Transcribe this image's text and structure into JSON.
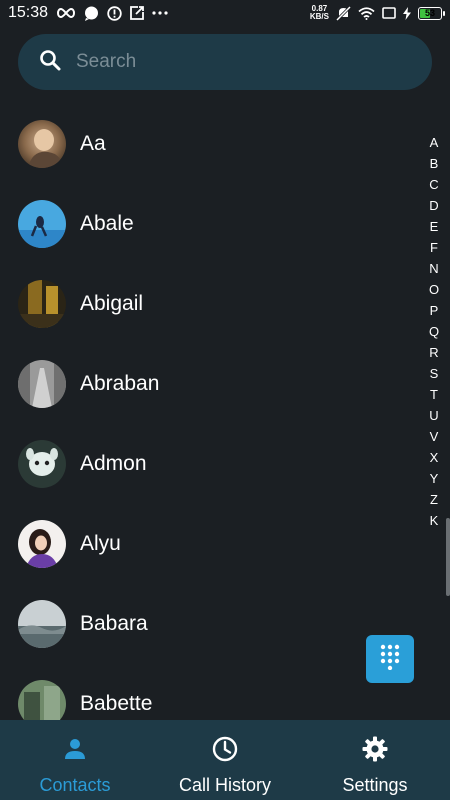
{
  "status_bar": {
    "time": "15:38",
    "speed_value": "0.87",
    "speed_unit": "KB/S",
    "battery": "53",
    "battery_level": 0.53,
    "icons": [
      "infinity-icon",
      "chat-bubble-icon",
      "alert-icon",
      "upload-icon",
      "more-dots-icon",
      "mute-icon",
      "wifi-icon",
      "screen-icon",
      "charging-icon"
    ]
  },
  "search": {
    "placeholder": "Search",
    "value": ""
  },
  "contacts": [
    {
      "name": "Aa"
    },
    {
      "name": "Abale"
    },
    {
      "name": "Abigail"
    },
    {
      "name": "Abraban"
    },
    {
      "name": "Admon"
    },
    {
      "name": "Alyu"
    },
    {
      "name": "Babara"
    },
    {
      "name": "Babette"
    }
  ],
  "alphabet_index": [
    "A",
    "B",
    "C",
    "D",
    "E",
    "F",
    "N",
    "O",
    "P",
    "Q",
    "R",
    "S",
    "T",
    "U",
    "V",
    "X",
    "Y",
    "Z",
    "K"
  ],
  "bottom_nav": [
    {
      "label": "Contacts",
      "icon": "person-icon",
      "active": true
    },
    {
      "label": "Call History",
      "icon": "clock-icon",
      "active": false
    },
    {
      "label": "Settings",
      "icon": "gear-icon",
      "active": false
    }
  ],
  "colors": {
    "background": "#1b1f23",
    "bar": "#1e3a47",
    "accent": "#2b9bd6",
    "fab": "#2a9fd8"
  }
}
